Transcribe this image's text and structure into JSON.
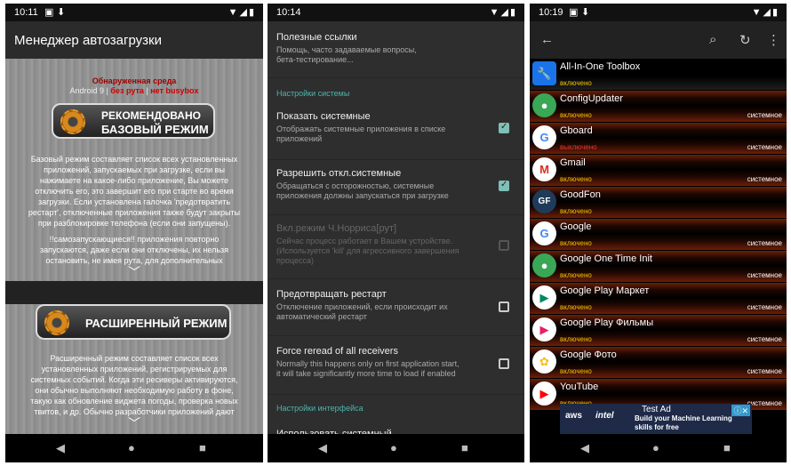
{
  "screens": [
    {
      "status": {
        "time": "10:11"
      },
      "appbar": {
        "title": "Менеджер автозагрузки"
      },
      "env": {
        "title": "Обнаруженная среда",
        "android": "Android 9",
        "divider": "|",
        "root": "без рута",
        "busybox": "нет busybox"
      },
      "basic": {
        "line1": "РЕКОМЕНДОВАНО",
        "line2": "БАЗОВЫЙ РЕЖИМ"
      },
      "basic_desc": [
        "Базовый режим составляет список всех установленных",
        "приложений, запускаемых при загрузке, если вы",
        "нажимаете на какое-либо приложение, Вы можете",
        "отключить его, это завершит его при старте во время",
        "загрузки. Если установлена галочка 'предотвратить",
        "рестарт', отключенные приложения также будут закрыты",
        "при разблокировке телефона (если они запущены)."
      ],
      "basic_desc2": [
        "!!самозапускающиеся!! приложения повторно",
        "запускаются, даже если они отключены, их нельзя",
        "остановить, не имея рута, для дополнительных"
      ],
      "advanced": {
        "label": "РАСШИРЕННЫЙ РЕЖИМ"
      },
      "advanced_desc": [
        "Расширенный режим составляет список всех",
        "установленных приложений, регистрируемых для",
        "системных событий. Когда эти ресиверы активируются,",
        "они обычно выполняют необходимую работу в фоне,",
        "такую как обновление виджета погоды, проверка новых",
        "твитов, и др. Обычно разработчики приложений дают"
      ]
    },
    {
      "status": {
        "time": "10:14"
      },
      "links": {
        "title": "Полезные ссылки",
        "summary": [
          "Помощь, часто задаваемые вопросы,",
          "бета-тестирование..."
        ]
      },
      "cat_system": "Настройки системы",
      "prefs": [
        {
          "title": "Показать системные",
          "summary": [
            "Отображать системные приложения в списке",
            "приложений"
          ],
          "checked": true,
          "enabled": true
        },
        {
          "title": "Разрешить откл.системные",
          "summary": [
            "Обращаться с осторожностью, системные",
            "приложения должны запускаться при загрузке"
          ],
          "checked": true,
          "enabled": true
        },
        {
          "title": "Вкл.режим Ч.Норриса[рут]",
          "summary": [
            "Сейчас процесс работает в Вашем устройстве.",
            "(Используется 'kill' для агрессивного завершения",
            "процесса)"
          ],
          "checked": false,
          "enabled": false
        },
        {
          "title": "Предотвращать рестарт",
          "summary": [
            "Отключение приложений, если происходит их",
            "автоматический рестарт"
          ],
          "checked": false,
          "enabled": true
        },
        {
          "title": "Force reread of all receivers",
          "summary": [
            "Normally this happens only on first application start,",
            "it will take significantly more time to load if enabled"
          ],
          "checked": false,
          "enabled": true
        }
      ],
      "cat_ui": "Настройки интерфейса",
      "partial": "Использовать системный"
    },
    {
      "status": {
        "time": "10:19"
      },
      "apps": [
        {
          "name": "All-In-One Toolbox",
          "state": "включено",
          "sys": "",
          "icon": "wrench-icon",
          "color": "#1a73e8",
          "glyph": "🔧"
        },
        {
          "name": "ConfigUpdater",
          "state": "включено",
          "sys": "системное",
          "icon": "android-icon",
          "color": "#3aa757",
          "glyph": "●"
        },
        {
          "name": "Gboard",
          "state": "выключено",
          "sys": "системное",
          "icon": "gboard-icon",
          "color": "#ffffff",
          "glyph": "G"
        },
        {
          "name": "Gmail",
          "state": "включено",
          "sys": "системное",
          "icon": "gmail-icon",
          "color": "#ffffff",
          "glyph": "M"
        },
        {
          "name": "GoodFon",
          "state": "включено",
          "sys": "",
          "icon": "goodfon-icon",
          "color": "#1f3b5a",
          "glyph": "GF"
        },
        {
          "name": "Google",
          "state": "включено",
          "sys": "системное",
          "icon": "google-icon",
          "color": "#ffffff",
          "glyph": "G"
        },
        {
          "name": "Google One Time Init",
          "state": "включено",
          "sys": "системное",
          "icon": "android-icon",
          "color": "#3aa757",
          "glyph": "●"
        },
        {
          "name": "Google Play Маркет",
          "state": "включено",
          "sys": "системное",
          "icon": "play-store-icon",
          "color": "#ffffff",
          "glyph": "▶"
        },
        {
          "name": "Google Play Фильмы",
          "state": "включено",
          "sys": "системное",
          "icon": "play-movies-icon",
          "color": "#ffffff",
          "glyph": "▶"
        },
        {
          "name": "Google Фото",
          "state": "включено",
          "sys": "системное",
          "icon": "photos-icon",
          "color": "#ffffff",
          "glyph": "✿"
        },
        {
          "name": "YouTube",
          "state": "включено",
          "sys": "системное",
          "icon": "youtube-icon",
          "color": "#ffffff",
          "glyph": "▶"
        }
      ],
      "ad": {
        "title": "Test Ad",
        "line1": "Build your Machine Learning",
        "line2": "skills for free",
        "logo1": "aws",
        "logo2": "intel"
      }
    }
  ]
}
